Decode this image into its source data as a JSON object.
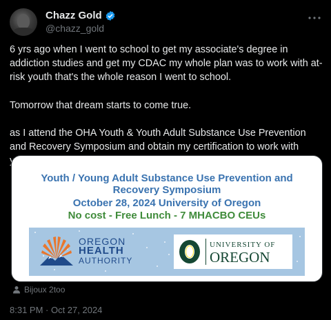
{
  "author": {
    "display_name": "Chazz Gold",
    "handle": "@chazz_gold",
    "verified_color": "#1d9bf0"
  },
  "tweet": {
    "paragraphs": [
      "6 yrs ago when I went to school to get my associate's degree in addiction studies and get my CDAC my whole plan was to work with at-risk youth that's the whole reason I went to school.",
      "Tomorrow that dream starts to come true.",
      "as I attend the  OHA Youth & Youth Adult Substance Use Prevention and Recovery Symposium and obtain my  certification to work with youth"
    ],
    "media_credit": "Bijoux 2too",
    "timestamp": "8:31 PM · Oct 27, 2024"
  },
  "flyer": {
    "title_line1": "Youth / Young Adult Substance Use Prevention and",
    "title_line2": "Recovery Symposium",
    "date_line": "October 28, 2024 University of Oregon",
    "cost_line": "No cost - Free Lunch - 7 MHACBO CEUs",
    "oha": {
      "line1": "OREGON",
      "line2": "HEALTH",
      "line3": "AUTHORITY"
    },
    "uo": {
      "line1": "UNIVERSITY OF",
      "line2": "OREGON"
    }
  },
  "colors": {
    "background": "#000000",
    "text": "#e7e9ea",
    "muted": "#71767b",
    "flyer_blue": "#3a73b0",
    "flyer_green": "#3f8b3a",
    "banner_blue": "#a6c6e2",
    "oha_orange": "#e8772e",
    "oha_navy": "#1f4a8a",
    "uo_green": "#154733"
  }
}
